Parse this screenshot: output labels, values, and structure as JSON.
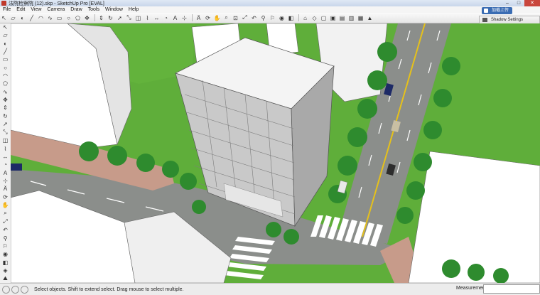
{
  "window": {
    "title": "法院检察院 (12).skp - SketchUp Pro [EVAL]",
    "minimize": "–",
    "maximize": "□",
    "close": "✕"
  },
  "menu": [
    "File",
    "Edit",
    "View",
    "Camera",
    "Draw",
    "Tools",
    "Window",
    "Help"
  ],
  "toolbar_icons": [
    "select-icon",
    "eraser-icon",
    "paint-icon",
    "line-icon",
    "arc-icon",
    "freehand-icon",
    "rectangle-icon",
    "circle-icon",
    "polygon-icon",
    "move-icon",
    "pushpull-icon",
    "rotate-icon",
    "followme-icon",
    "scale-icon",
    "offset-icon",
    "tape-icon",
    "dimension-icon",
    "protractor-icon",
    "text-icon",
    "axes-icon",
    "3dtext-icon",
    "orbit-icon",
    "pan-icon",
    "zoom-icon",
    "zoom-window-icon",
    "zoom-extents-icon",
    "previous-icon",
    "position-camera-icon",
    "walk-icon",
    "lookaround-icon",
    "section-icon",
    "home-icon",
    "iso-icon",
    "top-icon",
    "front-icon",
    "right-icon",
    "back-icon",
    "left-icon",
    "warehouse-icon"
  ],
  "side_icons": [
    "select-icon",
    "eraser-icon",
    "paint-icon",
    "line-icon",
    "rectangle-icon",
    "circle-icon",
    "arc-icon",
    "polygon-icon",
    "freehand-icon",
    "move-icon",
    "pushpull-icon",
    "rotate-icon",
    "followme-icon",
    "scale-icon",
    "offset-icon",
    "tape-icon",
    "dimension-icon",
    "protractor-icon",
    "text-icon",
    "axes-icon",
    "3dtext-icon",
    "orbit-icon",
    "pan-icon",
    "zoom-icon",
    "zoom-extents-icon",
    "previous-icon",
    "position-icon",
    "walk-icon",
    "look-icon",
    "section-icon",
    "sandbox-icon",
    "terrain-icon"
  ],
  "tray": {
    "badge": "加载上传",
    "panel": "Shadow Settings"
  },
  "status": {
    "text": "Select objects. Shift to extend select. Drag mouse to select multiple.",
    "measurements_label": "Measurements"
  },
  "colors": {
    "grass": "#5fae3a",
    "road": "#8b8e8b",
    "lane_yellow": "#e6c11a",
    "paving": "#c79b8a",
    "building_wall": "#ffffff",
    "tree": "#2e8b2e"
  }
}
